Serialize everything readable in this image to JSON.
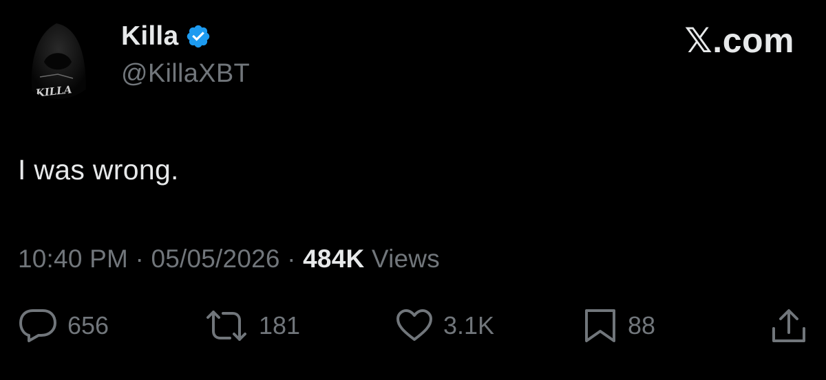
{
  "author": {
    "display_name": "Killa",
    "handle": "@KillaXBT",
    "verified": true,
    "avatar_text": "KILLA"
  },
  "brand": "𝕏.com",
  "tweet": {
    "text": "I was wrong."
  },
  "meta": {
    "time": "10:40 PM",
    "separator": " · ",
    "date": "05/05/2026",
    "views_count": "484K",
    "views_label": "Views"
  },
  "actions": {
    "replies": "656",
    "retweets": "181",
    "likes": "3.1K",
    "bookmarks": "88"
  },
  "colors": {
    "background": "#000000",
    "primary_text": "#e7e9ea",
    "secondary_text": "#71767b",
    "verified_blue": "#1d9bf0"
  }
}
